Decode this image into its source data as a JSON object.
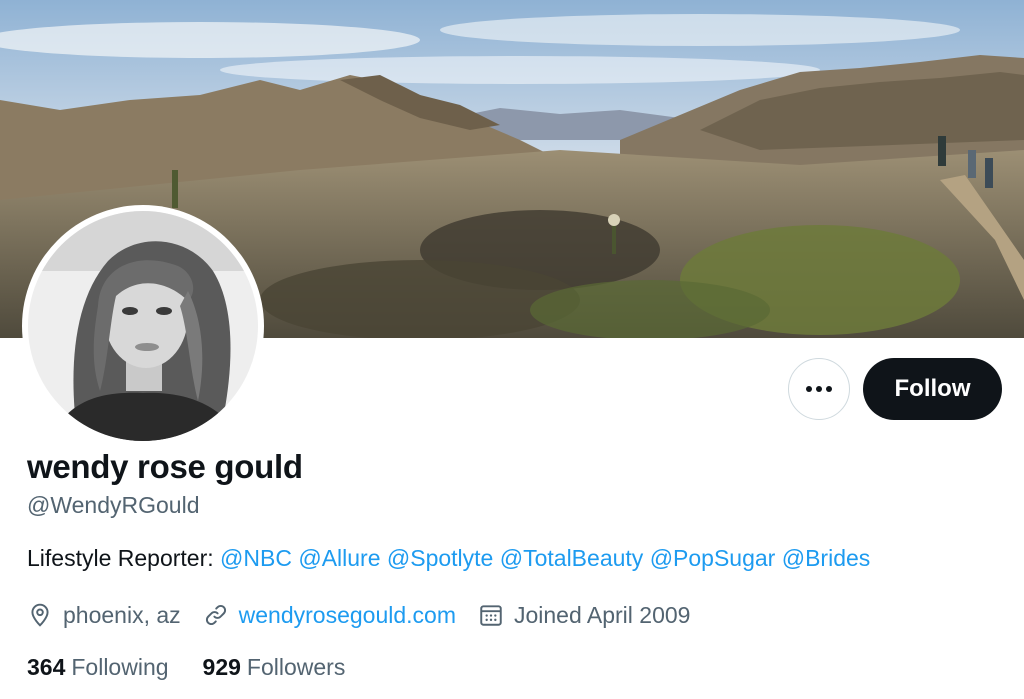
{
  "profile": {
    "display_name": "wendy rose gould",
    "handle": "@WendyRGould",
    "bio_prefix": "Lifestyle Reporter: ",
    "bio_mentions": [
      "@NBC",
      "@Allure",
      "@Spotlyte",
      "@TotalBeauty",
      "@PopSugar",
      "@Brides"
    ],
    "location": "phoenix, az",
    "website": "wendyrosegould.com",
    "joined": "Joined April 2009",
    "following_count": "364",
    "following_label": "Following",
    "followers_count": "929",
    "followers_label": "Followers"
  },
  "actions": {
    "follow_label": "Follow"
  },
  "icons": {
    "more": "more-horizontal-icon",
    "location": "location-pin-icon",
    "link": "link-icon",
    "calendar": "calendar-icon"
  },
  "colors": {
    "link": "#1d9bf0",
    "text": "#0f1419",
    "secondary": "#536471",
    "follow_bg": "#0f1419"
  }
}
